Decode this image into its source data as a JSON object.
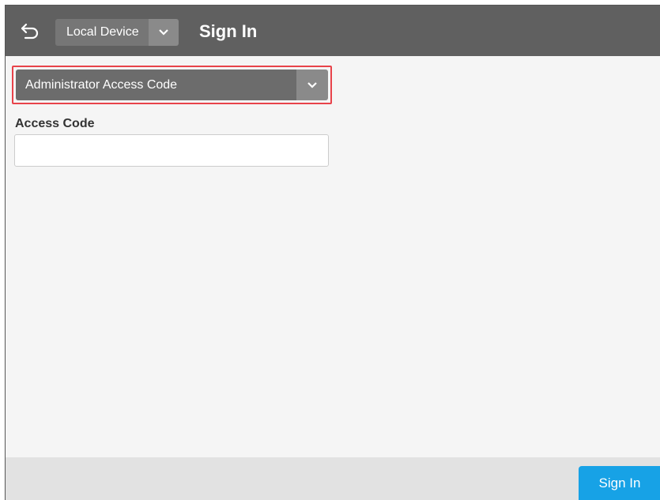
{
  "header": {
    "back_icon": "back-arrow-icon",
    "device_select": {
      "value": "Local Device",
      "icon": "chevron-down-icon"
    },
    "title": "Sign In"
  },
  "form": {
    "method_select": {
      "value": "Administrator Access Code",
      "icon": "chevron-down-icon"
    },
    "access_code": {
      "label": "Access Code",
      "value": "",
      "placeholder": ""
    }
  },
  "footer": {
    "sign_in_label": "Sign In",
    "sign_in_color": "#17a2e6"
  },
  "colors": {
    "header_bg": "#606060",
    "highlight_border": "#e8434a",
    "body_bg": "#f5f5f5"
  }
}
